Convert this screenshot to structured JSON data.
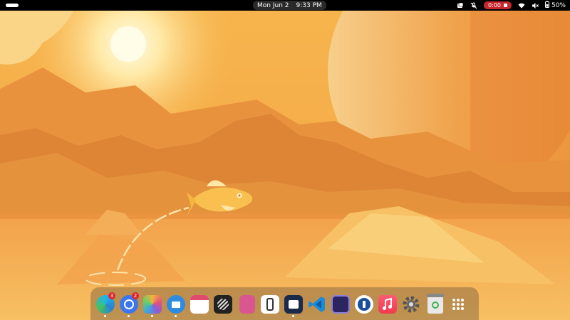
{
  "topbar": {
    "date": "Mon Jun 2",
    "time": "9:33 PM",
    "recording_time": "0:00",
    "battery": "50%"
  },
  "dock": {
    "items": [
      {
        "name": "edge",
        "badge": "3",
        "running": true
      },
      {
        "name": "signal",
        "badge": "2",
        "running": true
      },
      {
        "name": "photos",
        "badge": "",
        "running": true
      },
      {
        "name": "mail",
        "badge": "",
        "running": true
      },
      {
        "name": "calendar",
        "badge": "",
        "running": false
      },
      {
        "name": "linear",
        "badge": "",
        "running": false
      },
      {
        "name": "notebook",
        "badge": "",
        "running": false
      },
      {
        "name": "obsidian",
        "badge": "",
        "running": false
      },
      {
        "name": "files",
        "badge": "",
        "running": true
      },
      {
        "name": "vscode",
        "badge": "",
        "running": false
      },
      {
        "name": "teleprompter",
        "badge": "",
        "running": false
      },
      {
        "name": "1password",
        "badge": "",
        "running": false
      },
      {
        "name": "music",
        "badge": "",
        "running": false
      },
      {
        "name": "settings",
        "badge": "",
        "running": false
      },
      {
        "name": "trash",
        "badge": "",
        "running": false
      },
      {
        "name": "app-grid",
        "badge": "",
        "running": false
      }
    ]
  }
}
